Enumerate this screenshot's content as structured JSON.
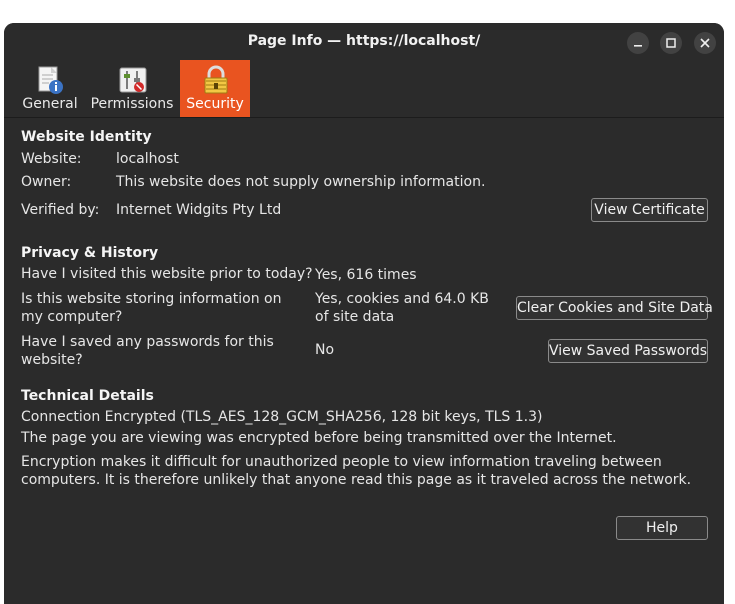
{
  "window": {
    "title": "Page Info — https://localhost/"
  },
  "tabs": [
    {
      "label": "General",
      "icon": "document-info-icon",
      "active": false
    },
    {
      "label": "Permissions",
      "icon": "permissions-switches-icon",
      "active": false
    },
    {
      "label": "Security",
      "icon": "padlock-icon",
      "active": true
    }
  ],
  "identity": {
    "heading": "Website Identity",
    "website_label": "Website:",
    "website_value": "localhost",
    "owner_label": "Owner:",
    "owner_value": "This website does not supply ownership information.",
    "verified_label": "Verified by:",
    "verified_value": "Internet Widgits Pty Ltd",
    "view_certificate_button": "View Certificate"
  },
  "privacy": {
    "heading": "Privacy & History",
    "visited_question": "Have I visited this website prior to today?",
    "visited_answer": "Yes, 616 times",
    "storing_question": "Is this website storing information on my computer?",
    "storing_answer": "Yes, cookies and 64.0 KB of site data",
    "clear_button": "Clear Cookies and Site Data",
    "passwords_question": "Have I saved any passwords for this website?",
    "passwords_answer": "No",
    "view_passwords_button": "View Saved Passwords"
  },
  "technical": {
    "heading": "Technical Details",
    "connection": "Connection Encrypted (TLS_AES_128_GCM_SHA256, 128 bit keys, TLS 1.3)",
    "line1": "The page you are viewing was encrypted before being transmitted over the Internet.",
    "line2": "Encryption makes it difficult for unauthorized people to view information traveling between computers. It is therefore unlikely that anyone read this page as it traveled across the network."
  },
  "help_button": "Help",
  "colors": {
    "accent": "#e95420",
    "background": "#2b2b2b"
  }
}
